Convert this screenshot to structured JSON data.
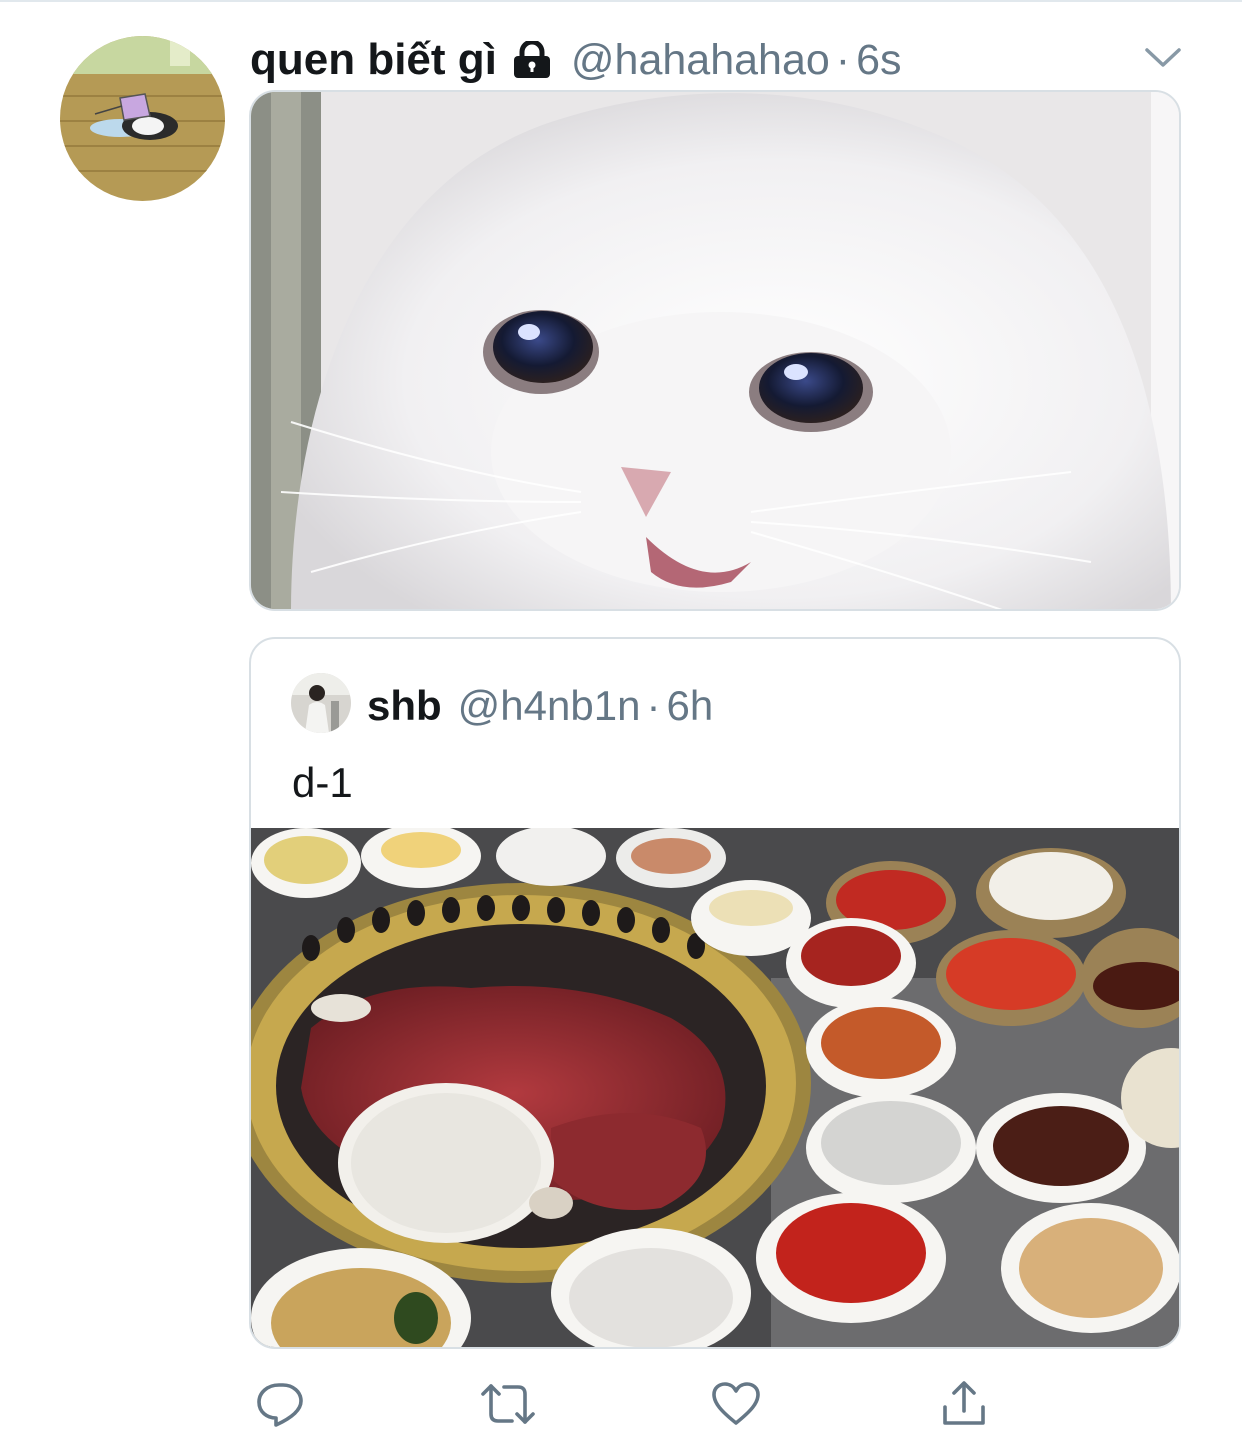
{
  "tweet": {
    "display_name": "quen biết gì",
    "handle": "@hahahahao",
    "separator": "·",
    "timestamp": "6s",
    "protected_icon": "lock-icon",
    "caret_icon": "chevron-down-icon",
    "avatar_icon": "avatar-kuromi-drawing"
  },
  "quoted_tweet": {
    "display_name": "shb",
    "handle": "@h4nb1n",
    "separator": "·",
    "timestamp": "6h",
    "text": "d-1",
    "avatar_icon": "avatar-person-photo",
    "media_icon": "photo-korean-bbq"
  },
  "actions": {
    "reply_icon": "reply-icon",
    "retweet_icon": "retweet-icon",
    "like_icon": "heart-icon",
    "share_icon": "share-icon"
  },
  "colors": {
    "text_primary": "#14171a",
    "text_secondary": "#657786",
    "border": "#d8dfe4",
    "icon": "#657786"
  }
}
